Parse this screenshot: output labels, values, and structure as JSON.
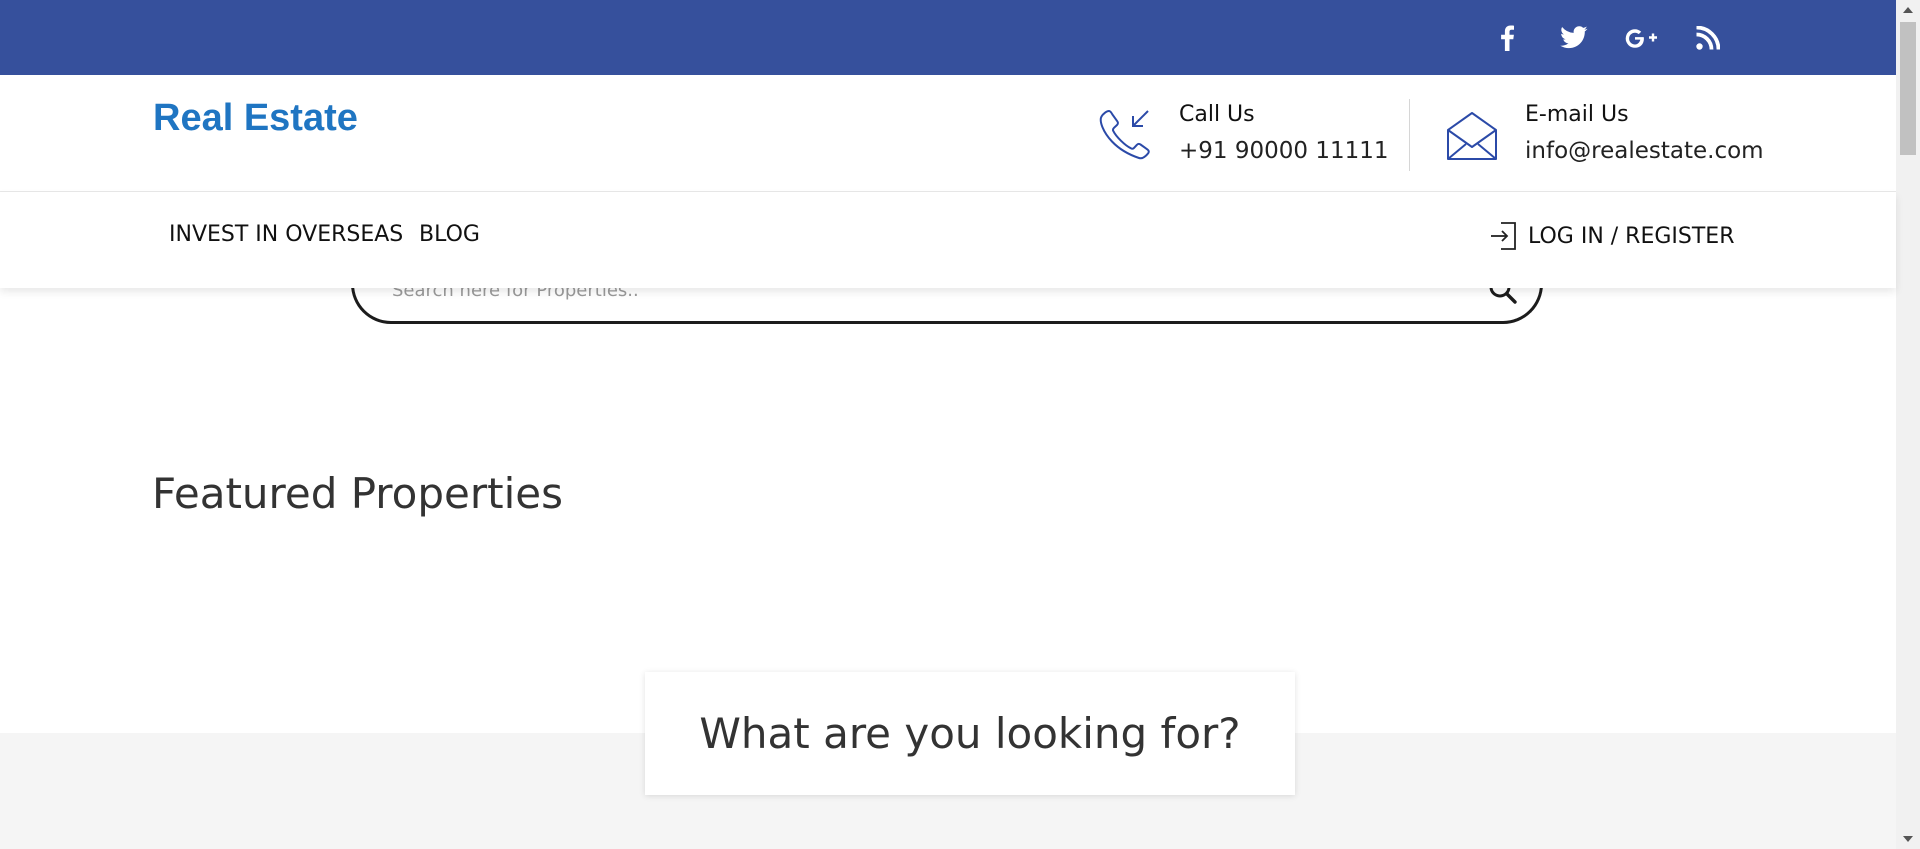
{
  "social": {
    "items": [
      {
        "name": "facebook"
      },
      {
        "name": "twitter"
      },
      {
        "name": "google-plus"
      },
      {
        "name": "rss"
      }
    ]
  },
  "header": {
    "logo": "Real Estate",
    "call": {
      "label": "Call Us",
      "value": "+91 90000 11111"
    },
    "email": {
      "label": "E-mail Us",
      "value": "info@realestate.com"
    }
  },
  "nav": {
    "items": [
      {
        "label": "INVEST IN OVERSEAS"
      },
      {
        "label": "BLOG"
      }
    ],
    "login": "LOG IN / REGISTER"
  },
  "search": {
    "placeholder": "Search here for Properties.."
  },
  "featured": {
    "title": "Featured Properties"
  },
  "looking": {
    "title": "What are you looking for?"
  },
  "colors": {
    "topbar": "#36509c",
    "logo": "#1f75c2",
    "icon_stroke": "#2b4aa8",
    "section_bg": "#f5f5f5"
  }
}
